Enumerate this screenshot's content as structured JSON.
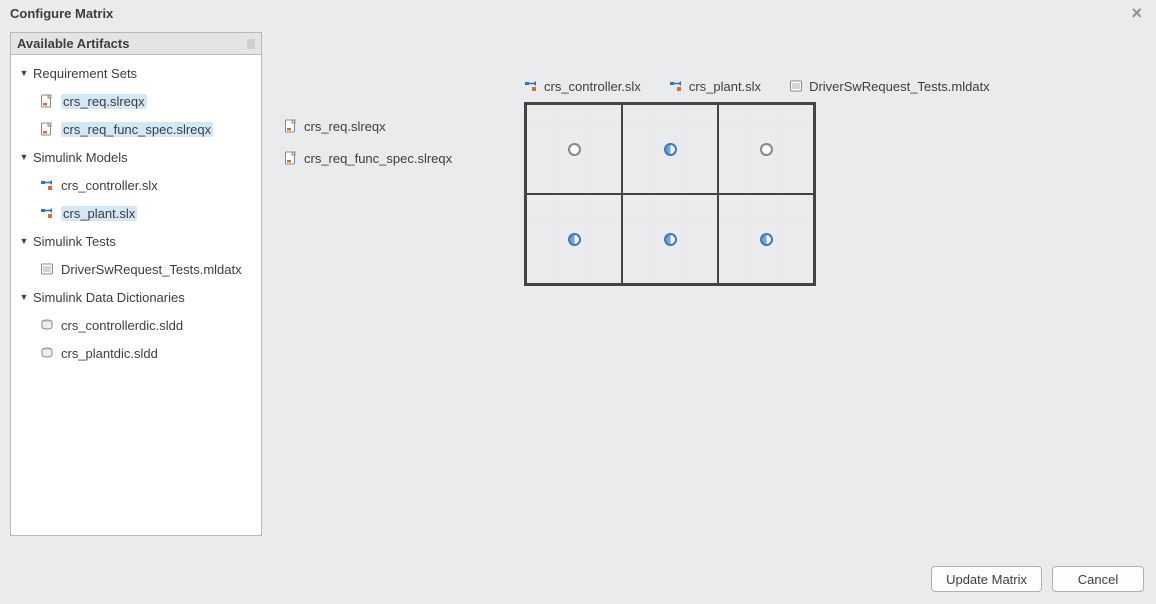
{
  "dialog": {
    "title": "Configure Matrix",
    "close_glyph": "×"
  },
  "tree": {
    "header": "Available Artifacts",
    "groups": [
      {
        "label": "Requirement Sets",
        "icon": "req-set",
        "items": [
          {
            "label": "crs_req.slreqx",
            "icon": "req-file",
            "selected": true
          },
          {
            "label": "crs_req_func_spec.slreqx",
            "icon": "req-file",
            "selected": true
          }
        ]
      },
      {
        "label": "Simulink Models",
        "icon": "model",
        "items": [
          {
            "label": "crs_controller.slx",
            "icon": "model-file",
            "selected": false
          },
          {
            "label": "crs_plant.slx",
            "icon": "model-file",
            "selected": true
          }
        ]
      },
      {
        "label": "Simulink Tests",
        "icon": "test",
        "items": [
          {
            "label": "DriverSwRequest_Tests.mldatx",
            "icon": "test-file",
            "selected": false
          }
        ]
      },
      {
        "label": "Simulink Data Dictionaries",
        "icon": "dd",
        "items": [
          {
            "label": "crs_controllerdic.sldd",
            "icon": "dd-file",
            "selected": false
          },
          {
            "label": "crs_plantdic.sldd",
            "icon": "dd-file",
            "selected": false
          }
        ]
      }
    ]
  },
  "matrix": {
    "rows": [
      {
        "label": "crs_req.slreqx",
        "icon": "req-file"
      },
      {
        "label": "crs_req_func_spec.slreqx",
        "icon": "req-file"
      }
    ],
    "cols": [
      {
        "label": "crs_controller.slx",
        "icon": "model-file"
      },
      {
        "label": "crs_plant.slx",
        "icon": "model-file"
      },
      {
        "label": "DriverSwRequest_Tests.mldatx",
        "icon": "test-file"
      }
    ],
    "cells": [
      [
        "empty",
        "half",
        "empty"
      ],
      [
        "half",
        "half",
        "half"
      ]
    ]
  },
  "footer": {
    "update": "Update Matrix",
    "cancel": "Cancel"
  }
}
